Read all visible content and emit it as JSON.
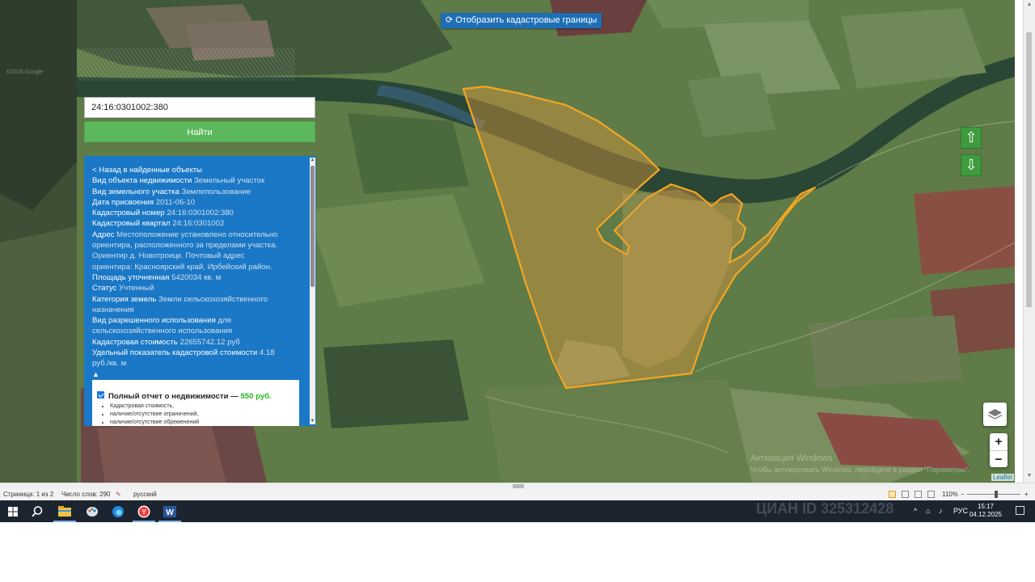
{
  "map": {
    "cadastral_button_label": "Отобразить кадастровые границы",
    "cadastral_button_icon": "refresh-icon",
    "search_value": "24:16:0301002:380",
    "find_button_label": "Найти",
    "google_watermark": "©2025 Google",
    "attribution": "Leaflet",
    "zoom_in_label": "+",
    "zoom_out_label": "−",
    "nav_up_icon": "arrow-up-icon",
    "nav_down_icon": "arrow-down-icon",
    "parcel_outline_color": "#f5a623"
  },
  "info": {
    "back_label": "< Назад в найденные объекты",
    "fields": [
      {
        "key": "Вид объекта недвижимости",
        "value": "Земельный участок"
      },
      {
        "key": "Вид земельного участка",
        "value": "Землепользование"
      },
      {
        "key": "Дата присвоения",
        "value": "2011-06-10"
      },
      {
        "key": "Кадастровый номер",
        "value": "24:16:0301002:380"
      },
      {
        "key": "Кадастровый квартал",
        "value": "24:16:0301002"
      },
      {
        "key": "Адрес",
        "value": "Местоположение установлено относительно ориентира, расположенного за пределами участка. Ориентир д. Новотроицк. Почтовый адрес ориентира: Красноярский край, Ирбейский район."
      },
      {
        "key": "Площадь уточненная",
        "value": "5420034 кв. м"
      },
      {
        "key": "Статус",
        "value": "Учтенный"
      },
      {
        "key": "Категория земель",
        "value": "Земли сельскохозяйственного назначения"
      },
      {
        "key": "Вид разрешенного использования",
        "value": "для сельскохозяйственного использования"
      },
      {
        "key": "Кадастровая стоимость",
        "value": "22655742.12 руб"
      },
      {
        "key": "Удельный показатель кадастровой стоимости",
        "value": "4.18 руб./кв. м"
      }
    ],
    "collapse_toggle": "▲",
    "report_title": "Полный отчет о недвижимости —",
    "report_price": "550 руб.",
    "report_checked": true,
    "report_items": [
      "Кадастровая стоимость,",
      "наличие/отсутствие ограничений,",
      "наличие/отсутствие обременений"
    ]
  },
  "watermark": {
    "line1": "Активация Windows",
    "line2": "Чтобы активировать Windows, перейдите в раздел \"Параметры\".",
    "cian": "ЦИАН  ID 325312428"
  },
  "statusbar": {
    "page": "Страница: 1 из 2",
    "words": "Число слов: 290",
    "language": "русский",
    "zoom": "110%"
  },
  "taskbar": {
    "apps": [
      "windows-start-icon",
      "search-icon",
      "file-explorer-icon",
      "paint-icon",
      "edge-icon",
      "yandex-browser-icon",
      "word-icon"
    ],
    "tray_lang": "РУС",
    "time": "15:17",
    "date": "04.12.2025"
  }
}
